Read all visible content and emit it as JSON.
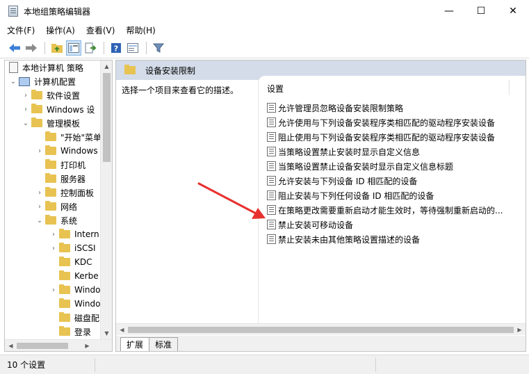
{
  "window": {
    "title": "本地组策略编辑器",
    "minimize_glyph": "—",
    "maximize_glyph": "☐",
    "close_glyph": "✕"
  },
  "menu": [
    "文件(F)",
    "操作(A)",
    "查看(V)",
    "帮助(H)"
  ],
  "toolbar_icons": [
    "back-icon",
    "forward-icon",
    "up-folder-icon",
    "show-hide-tree-icon",
    "export-list-icon",
    "help-icon",
    "properties-icon",
    "filter-icon"
  ],
  "tree": {
    "root": "本地计算机 策略",
    "computer_config": "计算机配置",
    "software_settings": "软件设置",
    "windows_settings": "Windows 设",
    "admin_templates": "管理模板",
    "start_menu": "\"开始\"菜单",
    "windows_components": "Windows",
    "printers": "打印机",
    "server": "服务器",
    "control_panel": "控制面板",
    "network": "网络",
    "system": "系统",
    "internet": "Intern",
    "iscsi": "iSCSI",
    "kdc": "KDC",
    "kerberos": "Kerbe",
    "windows_a": "Windo",
    "windows_b": "Windo",
    "disk_quota": "磁盘配",
    "logon": "登录"
  },
  "right_pane": {
    "header_title": "设备安装限制",
    "description": "选择一个项目来查看它的描述。",
    "column_header": "设置",
    "settings": [
      "允许管理员忽略设备安装限制策略",
      "允许使用与下列设备安装程序类相匹配的驱动程序安装设备",
      "阻止使用与下列设备安装程序类相匹配的驱动程序安装设备",
      "当策略设置禁止安装时显示自定义信息",
      "当策略设置禁止设备安装时显示自定义信息标题",
      "允许安装与下列设备 ID 相匹配的设备",
      "阻止安装与下列任何设备 ID 相匹配的设备",
      "在策略更改需要重新启动才能生效时，等待强制重新启动的...",
      "禁止安装可移动设备",
      "禁止安装未由其他策略设置描述的设备"
    ],
    "tabs": [
      "扩展",
      "标准"
    ]
  },
  "status": {
    "text": "10 个设置"
  },
  "colors": {
    "header_bg": "#d3dce8",
    "folder": "#e8c352",
    "annotation_arrow": "#e8312f"
  }
}
